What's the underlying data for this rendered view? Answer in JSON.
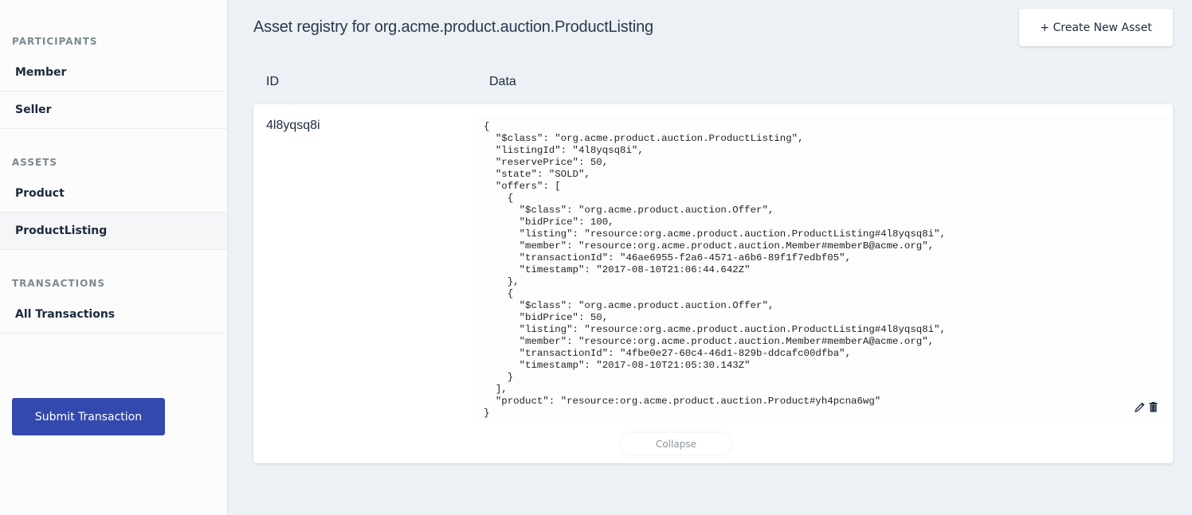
{
  "sidebar": {
    "sections": {
      "participants": {
        "title": "PARTICIPANTS",
        "items": [
          "Member",
          "Seller"
        ]
      },
      "assets": {
        "title": "ASSETS",
        "items": [
          "Product",
          "ProductListing"
        ],
        "active": "ProductListing"
      },
      "transactions": {
        "title": "TRANSACTIONS",
        "items": [
          "All Transactions"
        ]
      }
    },
    "submit_button": "Submit Transaction"
  },
  "header": {
    "title": "Asset registry for org.acme.product.auction.ProductListing",
    "create_button": "+ Create New Asset"
  },
  "table": {
    "columns": [
      "ID",
      "Data"
    ],
    "rows": [
      {
        "id": "4l8yqsq8i",
        "data": "{\n  \"$class\": \"org.acme.product.auction.ProductListing\",\n  \"listingId\": \"4l8yqsq8i\",\n  \"reservePrice\": 50,\n  \"state\": \"SOLD\",\n  \"offers\": [\n    {\n      \"$class\": \"org.acme.product.auction.Offer\",\n      \"bidPrice\": 100,\n      \"listing\": \"resource:org.acme.product.auction.ProductListing#4l8yqsq8i\",\n      \"member\": \"resource:org.acme.product.auction.Member#memberB@acme.org\",\n      \"transactionId\": \"46ae6955-f2a6-4571-a6b6-89f1f7edbf05\",\n      \"timestamp\": \"2017-08-10T21:06:44.642Z\"\n    },\n    {\n      \"$class\": \"org.acme.product.auction.Offer\",\n      \"bidPrice\": 50,\n      \"listing\": \"resource:org.acme.product.auction.ProductListing#4l8yqsq8i\",\n      \"member\": \"resource:org.acme.product.auction.Member#memberA@acme.org\",\n      \"transactionId\": \"4fbe0e27-60c4-46d1-829b-ddcafc00dfba\",\n      \"timestamp\": \"2017-08-10T21:05:30.143Z\"\n    }\n  ],\n  \"product\": \"resource:org.acme.product.auction.Product#yh4pcna6wg\"\n}",
        "actions": {
          "edit_icon": "pencil-icon",
          "delete_icon": "trash-icon"
        },
        "collapse_label": "Collapse"
      }
    ]
  },
  "colors": {
    "primary": "#3449ad",
    "background": "#edf0f5",
    "sidebar_bg": "#fcfcfc",
    "text": "#1b2a3d",
    "section_title": "#7a8a90"
  }
}
